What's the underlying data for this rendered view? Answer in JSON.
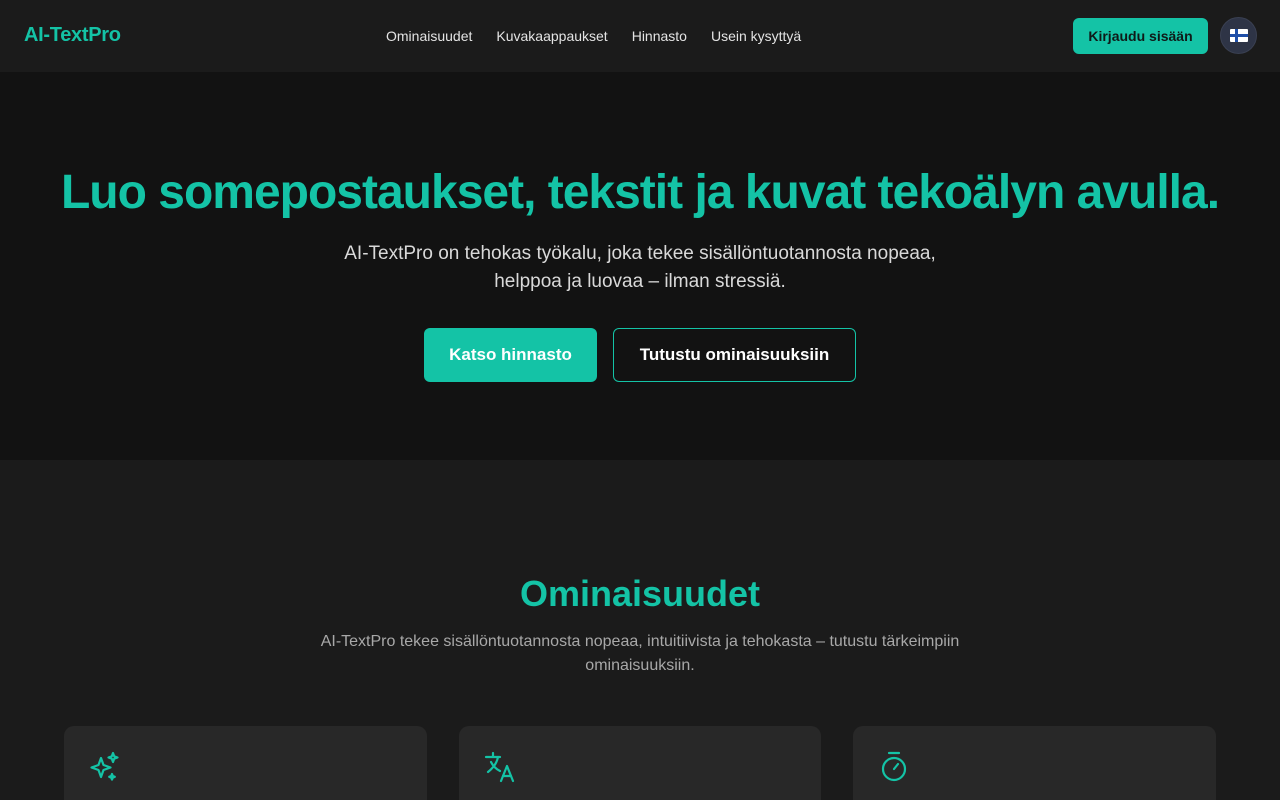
{
  "brand": {
    "name": "AI-TextPro",
    "accent": "#14c3a6"
  },
  "nav": {
    "items": [
      {
        "label": "Ominaisuudet"
      },
      {
        "label": "Kuvakaappaukset"
      },
      {
        "label": "Hinnasto"
      },
      {
        "label": "Usein kysyttyä"
      }
    ],
    "login_label": "Kirjaudu sisään",
    "language_icon": "finland-flag-icon"
  },
  "hero": {
    "title": "Luo somepostaukset, tekstit ja kuvat tekoälyn avulla.",
    "subtitle_line1": "AI-TextPro on tehokas työkalu, joka tekee sisällöntuotannosta nopeaa,",
    "subtitle_line2": "helppoa ja luovaa – ilman stressiä.",
    "primary_cta": "Katso hinnasto",
    "secondary_cta": "Tutustu ominaisuuksiin"
  },
  "features": {
    "title": "Ominaisuudet",
    "subtitle_line1": "AI-TextPro tekee sisällöntuotannosta nopeaa, intuitiivista ja tehokasta – tutustu tärkeimpiin",
    "subtitle_line2": "ominaisuuksiin.",
    "cards": [
      {
        "icon": "sparkles-icon"
      },
      {
        "icon": "translate-icon"
      },
      {
        "icon": "timer-icon"
      }
    ]
  }
}
